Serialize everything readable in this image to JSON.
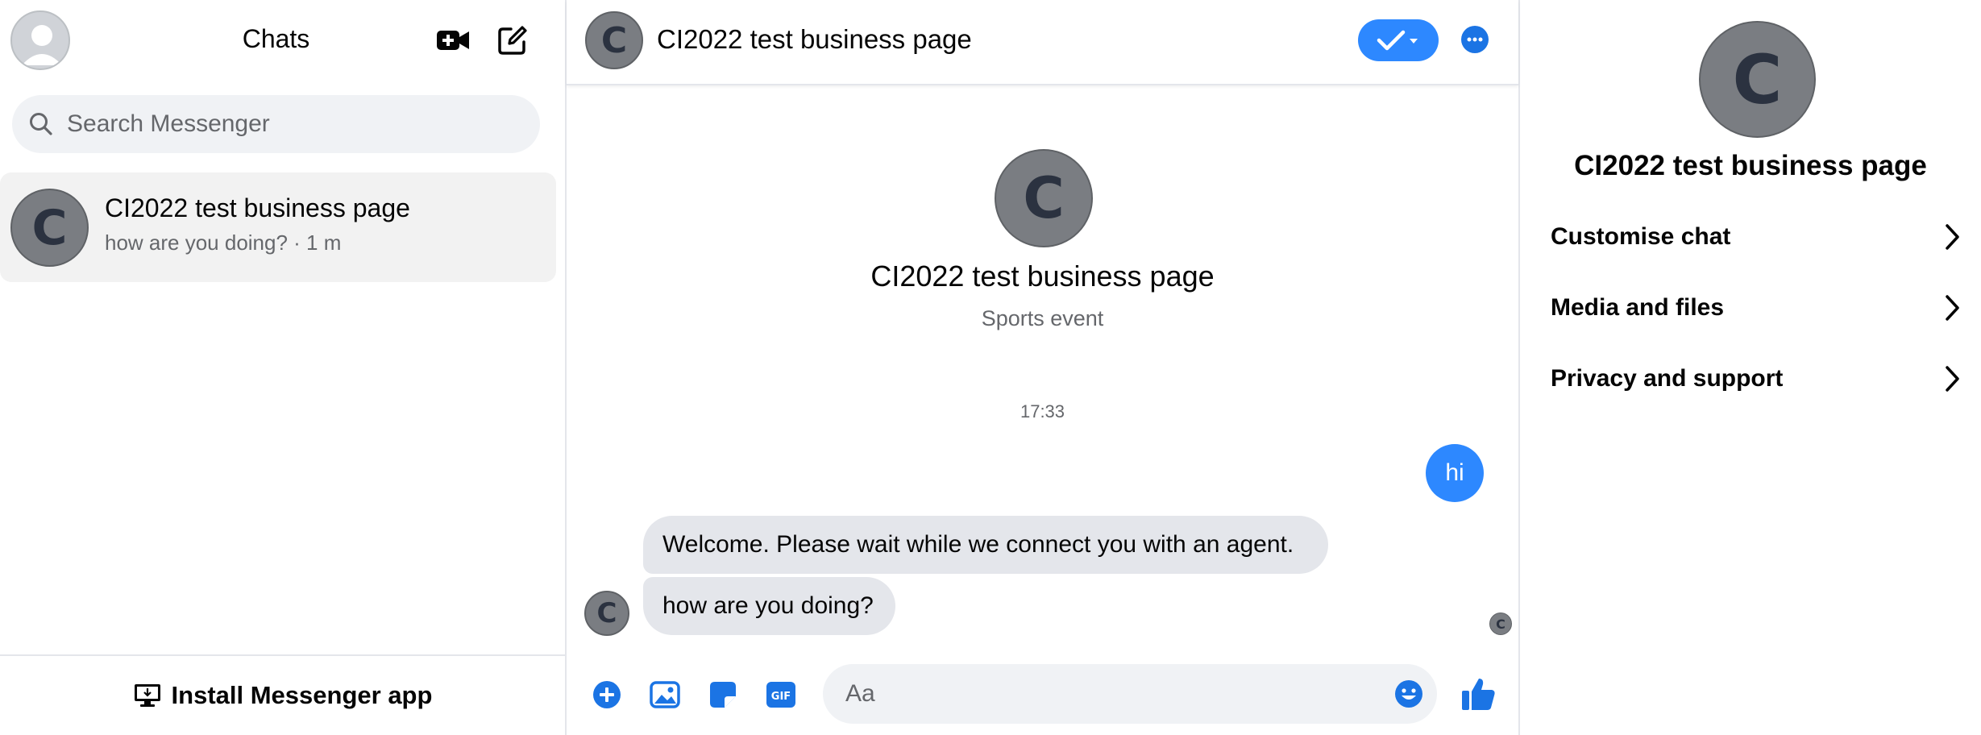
{
  "sidebar": {
    "title": "Chats",
    "search_placeholder": "Search Messenger",
    "chats": [
      {
        "avatar_letter": "C",
        "name": "CI2022 test business page",
        "preview": "how are you doing? · 1 m"
      }
    ],
    "install_label": "Install Messenger app"
  },
  "conversation": {
    "avatar_letter": "C",
    "title": "CI2022 test business page",
    "intro": {
      "name": "CI2022 test business page",
      "subtitle": "Sports event"
    },
    "timestamp": "17:33",
    "messages": [
      {
        "from": "me",
        "text": "hi"
      },
      {
        "from": "page",
        "text": "Welcome. Please wait while we connect you with an agent."
      },
      {
        "from": "page",
        "text": "how are you doing?"
      }
    ],
    "composer_placeholder": "Aa"
  },
  "info_panel": {
    "avatar_letter": "C",
    "name": "CI2022 test business page",
    "rows": [
      {
        "label": "Customise chat"
      },
      {
        "label": "Media and files"
      },
      {
        "label": "Privacy and support"
      }
    ]
  },
  "icons": {
    "video": "video-plus-icon",
    "compose": "compose-icon",
    "search": "search-icon",
    "status": "check-done-icon",
    "more": "more-icon",
    "composer": [
      "plus-circle-icon",
      "photo-icon",
      "sticker-icon",
      "gif-icon"
    ],
    "emoji": "emoji-icon",
    "like": "thumbs-up-icon",
    "chevron": "chevron-right-icon",
    "desktop": "desktop-download-icon"
  },
  "colors": {
    "accent": "#2d88ff",
    "bubble_in": "#e4e6eb",
    "avatar_bg": "#7a7d82",
    "secondary_text": "#65676b"
  }
}
